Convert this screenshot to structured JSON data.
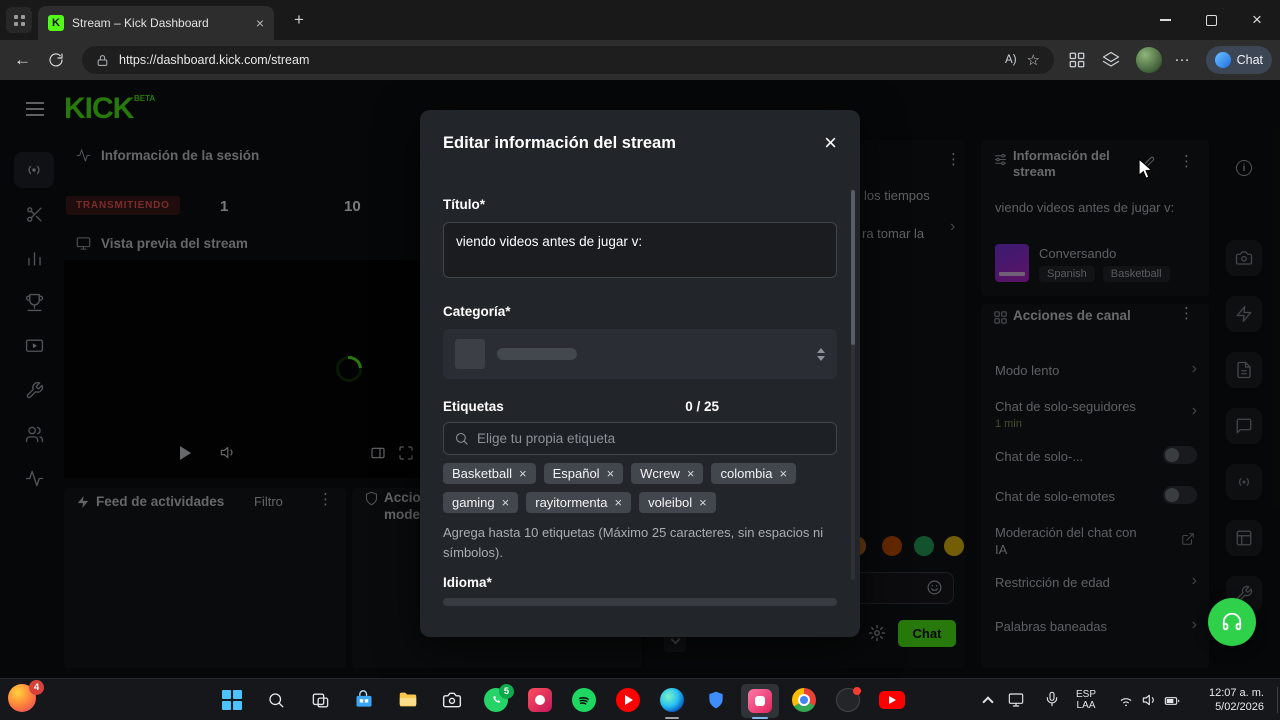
{
  "icons": {
    "close": "×",
    "kebab": "⋮",
    "chevron": "›",
    "plus": "+",
    "back": "←",
    "star": "☆",
    "read_aloud": "A)",
    "ellipsis": "…",
    "kick_k": "K",
    "info": "i"
  },
  "browser": {
    "tab_title": "Stream – Kick Dashboard",
    "url": "https://dashboard.kick.com/stream",
    "chat_label": "Chat"
  },
  "dashboard": {
    "logo": "KICK",
    "beta": "BETA",
    "session": {
      "title": "Información de la sesión",
      "live_badge": "TRANSMITIENDO",
      "stat_viewers": "1",
      "stat_followers": "10"
    },
    "preview_title": "Vista previa del stream",
    "feed": {
      "title": "Feed de actividades",
      "filter_label": "Filtro"
    },
    "moderation": {
      "line1": "Accio",
      "line2": "moder"
    },
    "chat": {
      "fragment1": "los tiempos",
      "fragment2": "ra tomar la",
      "send_label": "Chat"
    }
  },
  "stream_info": {
    "panel_title": "Información del stream",
    "stream_title": "viendo videos antes de jugar v:",
    "category": "Conversando",
    "tags": [
      "Spanish",
      "Basketball"
    ]
  },
  "channel_actions": {
    "panel_title": "Acciones de canal",
    "items": [
      {
        "label": "Modo lento"
      },
      {
        "label": "Chat de solo-seguidores",
        "sub": "1 min"
      },
      {
        "label": "Chat de solo-..."
      },
      {
        "label": "Chat de solo-emotes"
      },
      {
        "label": "Moderación del chat con IA"
      },
      {
        "label": "Restricción de edad"
      },
      {
        "label": "Palabras baneadas"
      }
    ]
  },
  "modal": {
    "title": "Editar información del stream",
    "title_label": "Título*",
    "title_value": "viendo videos antes de jugar v:",
    "category_label": "Categoría*",
    "tags_label": "Etiquetas",
    "tags_counter": "0 / 25",
    "tag_search_placeholder": "Elige tu propia etiqueta",
    "tags": [
      "Basketball",
      "Español",
      "Wcrew",
      "colombia",
      "gaming",
      "rayitormenta",
      "voleibol"
    ],
    "helper_text": "Agrega hasta 10 etiquetas (Máximo 25 caracteres, sin espacios ni símbolos).",
    "language_label": "Idioma*"
  },
  "taskbar": {
    "clock_time": "12:07 a. m.",
    "clock_date": "5/02/2026",
    "lang_top": "ESP",
    "lang_bottom": "LAA",
    "whatsapp_badge": "5",
    "pinned_badge": "4"
  },
  "colors": {
    "kick_green": "#53fc18",
    "live_red": "#ff5b5b",
    "support_green": "#2fd14b"
  }
}
